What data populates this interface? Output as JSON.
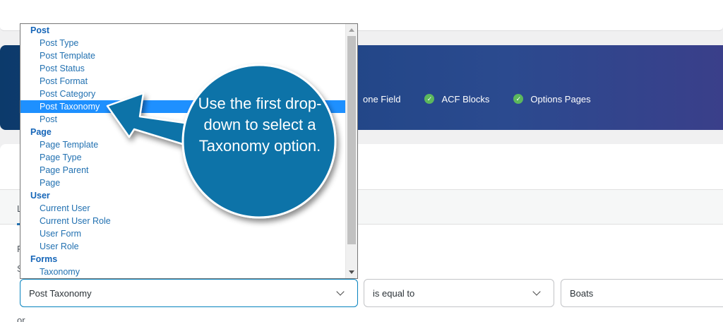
{
  "banner": {
    "features": [
      {
        "label": "one Field"
      },
      {
        "label": "ACF Blocks"
      },
      {
        "label": "Options Pages"
      }
    ]
  },
  "background_fragments": {
    "tab_initial": "L",
    "row_initial_1": "F",
    "row_initial_2": "S",
    "or_text": "or"
  },
  "rule_row": {
    "param_value": "Post Taxonomy",
    "operator_value": "is equal to",
    "value_value": "Boats"
  },
  "dropdown": {
    "selected": "Post Taxonomy",
    "options": [
      {
        "label": "Post",
        "type": "group"
      },
      {
        "label": "Post Type",
        "type": "item"
      },
      {
        "label": "Post Template",
        "type": "item"
      },
      {
        "label": "Post Status",
        "type": "item"
      },
      {
        "label": "Post Format",
        "type": "item"
      },
      {
        "label": "Post Category",
        "type": "item"
      },
      {
        "label": "Post Taxonomy",
        "type": "item",
        "selected": true
      },
      {
        "label": "Post",
        "type": "item"
      },
      {
        "label": "Page",
        "type": "group"
      },
      {
        "label": "Page Template",
        "type": "item"
      },
      {
        "label": "Page Type",
        "type": "item"
      },
      {
        "label": "Page Parent",
        "type": "item"
      },
      {
        "label": "Page",
        "type": "item"
      },
      {
        "label": "User",
        "type": "group"
      },
      {
        "label": "Current User",
        "type": "item"
      },
      {
        "label": "Current User Role",
        "type": "item"
      },
      {
        "label": "User Form",
        "type": "item"
      },
      {
        "label": "User Role",
        "type": "item"
      },
      {
        "label": "Forms",
        "type": "group"
      },
      {
        "label": "Taxonomy",
        "type": "item"
      }
    ]
  },
  "callout": {
    "text": "Use the first drop-down to select a Taxonomy option.",
    "color": "#0a73a8"
  },
  "colors": {
    "accent": "#2271b1",
    "selected_bg": "#1e90ff",
    "check_green": "#5cb85c"
  }
}
